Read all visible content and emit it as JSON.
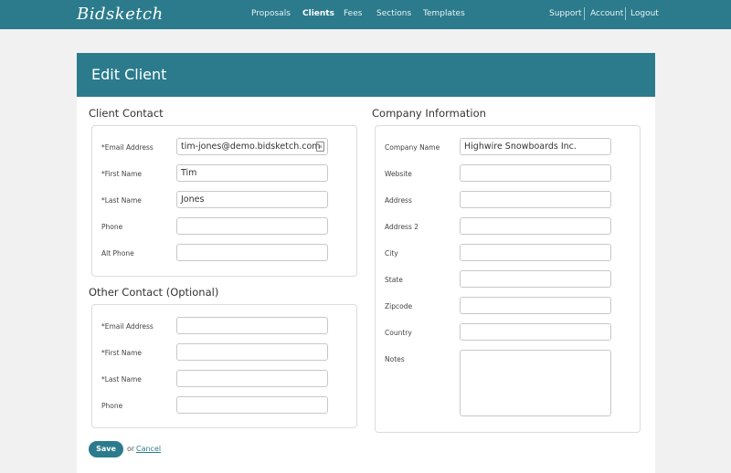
{
  "brand": {
    "logo": "Bidsketch"
  },
  "nav": {
    "items": [
      "Proposals",
      "Clients",
      "Fees",
      "Sections",
      "Templates"
    ],
    "right": [
      "Support",
      "Account",
      "Logout"
    ]
  },
  "page": {
    "title": "Edit Client"
  },
  "client_contact": {
    "title": "Client Contact",
    "labels": [
      "*Email Address",
      "*First Name",
      "*Last Name",
      "Phone",
      "Alt Phone"
    ],
    "values": [
      "tim-jones@demo.bidsketch.com",
      "Tim",
      "Jones",
      "",
      ""
    ]
  },
  "other_contact": {
    "title": "Other Contact (Optional)",
    "labels": [
      "*Email Address",
      "*First Name",
      "*Last Name",
      "Phone"
    ],
    "values": [
      "",
      "",
      "",
      ""
    ]
  },
  "company": {
    "title": "Company Information",
    "labels": [
      "Company Name",
      "Website",
      "Address",
      "Address 2",
      "City",
      "State",
      "Zipcode",
      "Country",
      "Notes"
    ],
    "values": [
      "Highwire Snowboards Inc.",
      "",
      "",
      "",
      "",
      "",
      "",
      "",
      ""
    ]
  },
  "actions": {
    "save": "Save",
    "or": "or",
    "cancel": "Cancel"
  },
  "colors": {
    "brand": "#2b7b8c",
    "background": "#f1f1f1"
  }
}
